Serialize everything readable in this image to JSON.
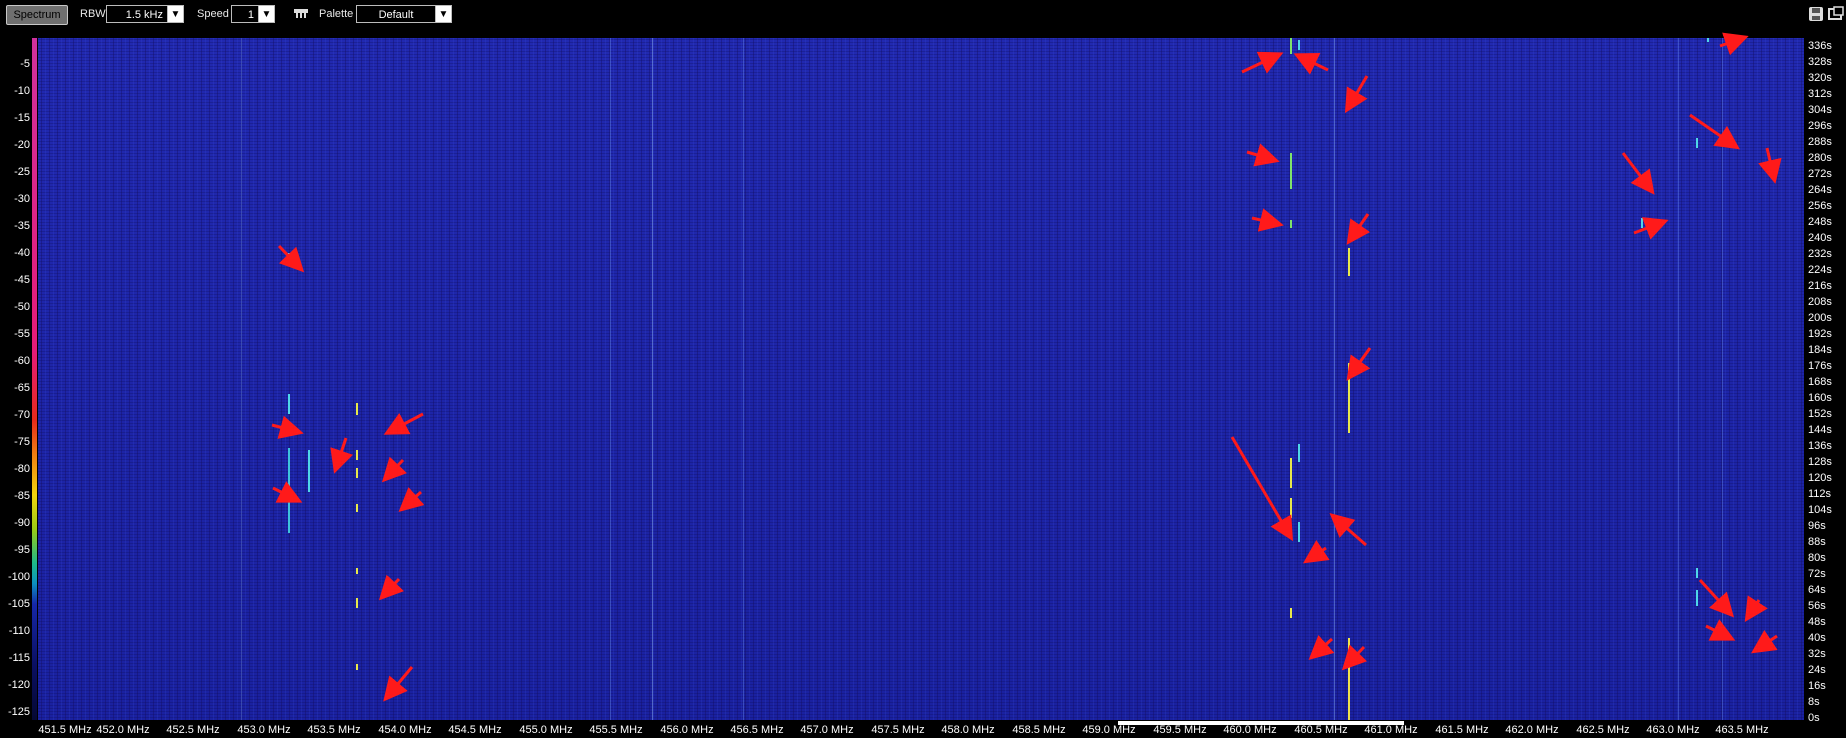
{
  "toolbar": {
    "spectrum_button": "Spectrum",
    "rbw_label": "RBW",
    "rbw_value": "1.5 kHz",
    "speed_label": "Speed",
    "speed_value": "1",
    "palette_label": "Palette",
    "palette_value": "Default",
    "dropdown_icon": "chevron-down-icon",
    "filter_icon": "filter-icon",
    "save_icon": "save-icon",
    "window_icon": "window-icon"
  },
  "y_axis_left": {
    "labels": [
      "-5",
      "-10",
      "-15",
      "-20",
      "-25",
      "-30",
      "-35",
      "-40",
      "-45",
      "-50",
      "-55",
      "-60",
      "-65",
      "-70",
      "-75",
      "-80",
      "-85",
      "-90",
      "-95",
      "-100",
      "-105",
      "-110",
      "-115",
      "-120",
      "-125"
    ]
  },
  "y_axis_right": {
    "labels": [
      "336s",
      "328s",
      "320s",
      "312s",
      "304s",
      "296s",
      "288s",
      "280s",
      "272s",
      "264s",
      "256s",
      "248s",
      "240s",
      "232s",
      "224s",
      "216s",
      "208s",
      "200s",
      "192s",
      "184s",
      "176s",
      "168s",
      "160s",
      "152s",
      "144s",
      "136s",
      "128s",
      "120s",
      "112s",
      "104s",
      "96s",
      "88s",
      "80s",
      "72s",
      "64s",
      "56s",
      "48s",
      "40s",
      "32s",
      "24s",
      "16s",
      "8s",
      "0s"
    ]
  },
  "x_axis": {
    "labels": [
      "451.5 MHz",
      "452.0 MHz",
      "452.5 MHz",
      "453.0 MHz",
      "453.5 MHz",
      "454.0 MHz",
      "454.5 MHz",
      "455.0 MHz",
      "455.5 MHz",
      "456.0 MHz",
      "456.5 MHz",
      "457.0 MHz",
      "457.5 MHz",
      "458.0 MHz",
      "458.5 MHz",
      "459.0 MHz",
      "459.5 MHz",
      "460.0 MHz",
      "460.5 MHz",
      "461.0 MHz",
      "461.5 MHz",
      "462.0 MHz",
      "462.5 MHz",
      "463.0 MHz",
      "463.5 MHz"
    ]
  },
  "colors": {
    "background": "#1e25a6",
    "signal_cyan": "#4fd6e8",
    "signal_yellow": "#e8e84a",
    "arrow": "#ff1a1a"
  }
}
